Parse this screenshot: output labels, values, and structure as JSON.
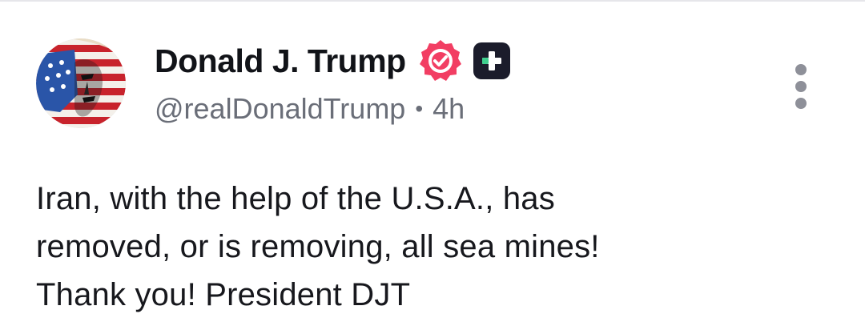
{
  "post": {
    "author": {
      "display_name": "Donald J. Trump",
      "handle": "@realDonaldTrump",
      "separator": "•",
      "timestamp": "4h"
    },
    "badges": {
      "verified_icon": "verified-badge-icon",
      "verified_color": "#f23e63",
      "plus_icon": "plus-square-icon",
      "plus_bg_color": "#1b1c2b",
      "plus_accent_color": "#3fcf8e"
    },
    "more_icon": "more-vertical-icon",
    "body_lines": [
      "Iran, with the help of the U.S.A., has",
      "removed, or is removing, all sea mines!",
      "Thank you! President DJT"
    ]
  }
}
